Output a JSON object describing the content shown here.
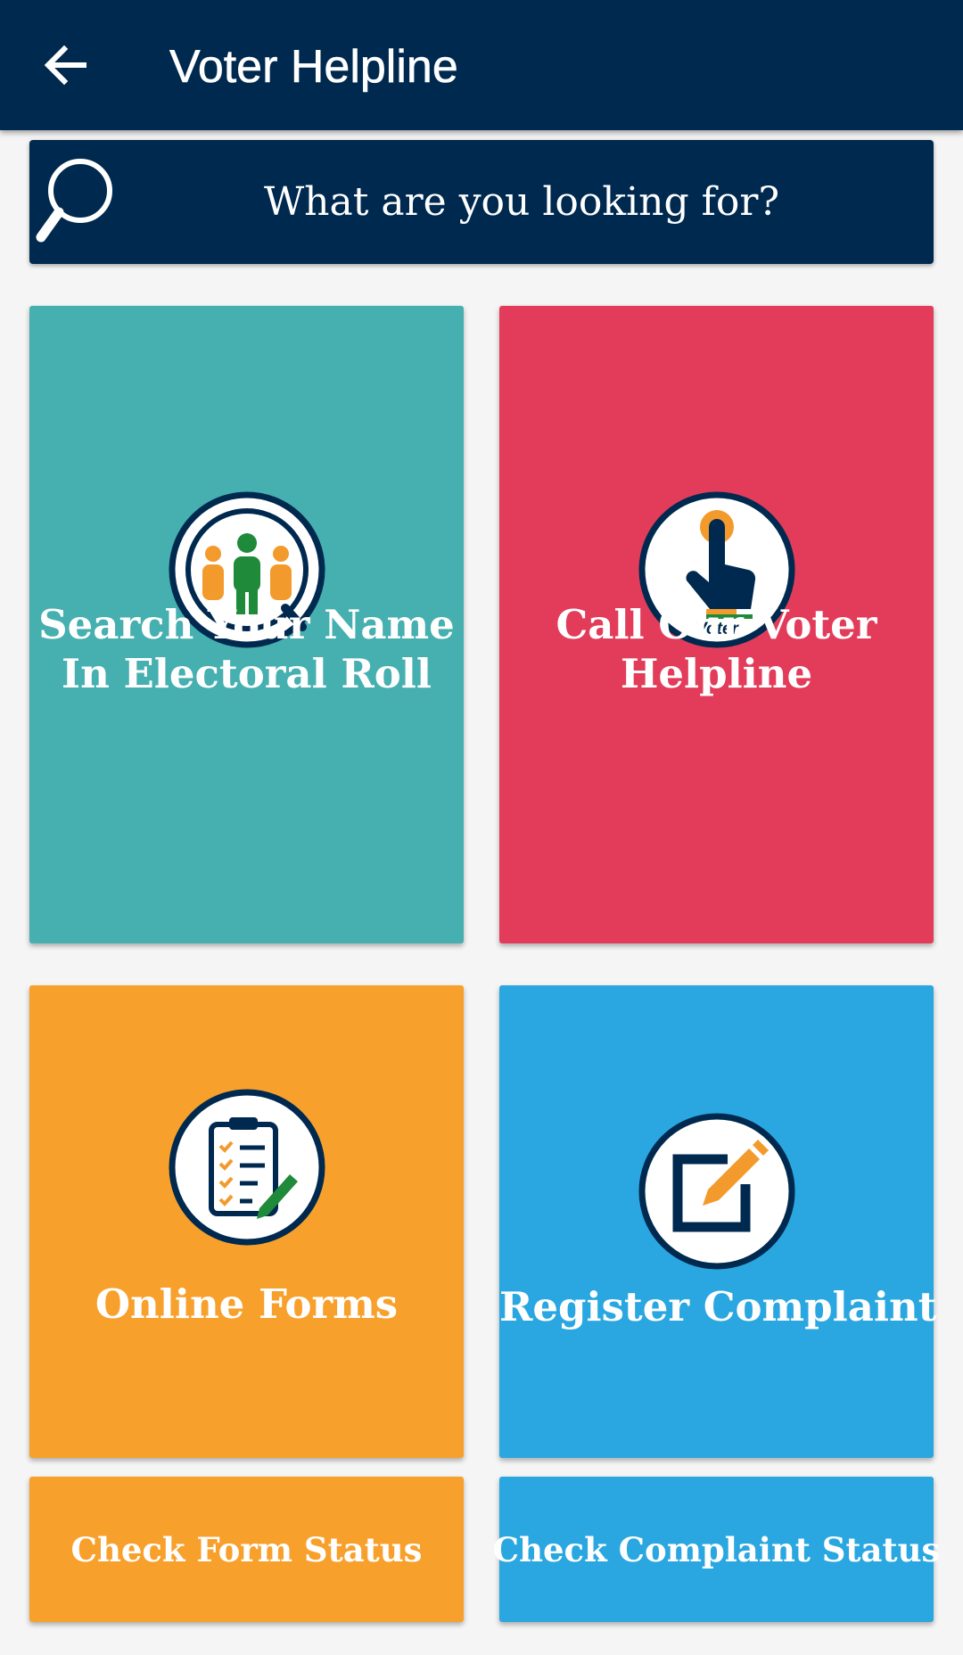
{
  "appbar": {
    "title": "Voter Helpline",
    "back_icon": "arrow-left-icon"
  },
  "search": {
    "placeholder": "What are you looking for?",
    "icon": "search-icon"
  },
  "colors": {
    "navy": "#00294f",
    "teal": "#46afaf",
    "red": "#e23c5a",
    "orange": "#f8a02c",
    "blue": "#2aa7e0",
    "background": "#f5f5f5"
  },
  "tiles": [
    {
      "lines": [
        "Search Your Name",
        "In Electoral Roll"
      ],
      "icon": "people-magnifier-icon",
      "color": "#46afaf"
    },
    {
      "lines": [
        "Call Our Voter",
        "Helpline"
      ],
      "icon": "voter-finger-icon",
      "color": "#e23c5a"
    },
    {
      "lines": [
        "Online Forms"
      ],
      "icon": "clipboard-pencil-icon",
      "color": "#f8a02c"
    },
    {
      "lines": [
        "Register Complaint"
      ],
      "icon": "edit-box-icon",
      "color": "#2aa7e0"
    }
  ],
  "status_buttons": [
    {
      "label": "Check Form Status",
      "color": "#f8a02c"
    },
    {
      "label": "Check Complaint Status",
      "color": "#2aa7e0"
    }
  ],
  "voter_badge_text": "Voter"
}
